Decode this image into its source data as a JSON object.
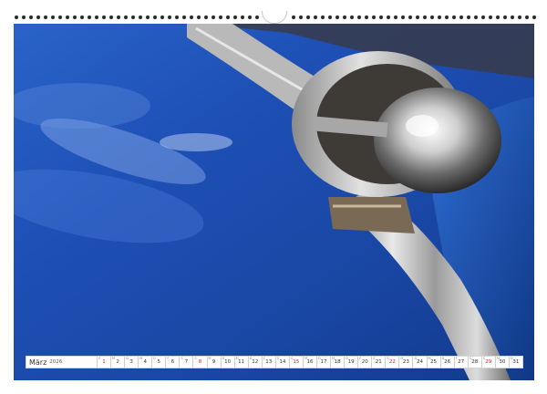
{
  "calendar": {
    "month": "März",
    "year": "2026",
    "days": [
      {
        "n": "1",
        "w": "S",
        "sun": true
      },
      {
        "n": "2",
        "w": "M"
      },
      {
        "n": "3",
        "w": "D"
      },
      {
        "n": "4",
        "w": "M"
      },
      {
        "n": "5",
        "w": "D"
      },
      {
        "n": "6",
        "w": "F"
      },
      {
        "n": "7",
        "w": "S"
      },
      {
        "n": "8",
        "w": "S",
        "sun": true
      },
      {
        "n": "9",
        "w": "M"
      },
      {
        "n": "10",
        "w": "D"
      },
      {
        "n": "11",
        "w": "M"
      },
      {
        "n": "12",
        "w": "D"
      },
      {
        "n": "13",
        "w": "F"
      },
      {
        "n": "14",
        "w": "S"
      },
      {
        "n": "15",
        "w": "S",
        "sun": true
      },
      {
        "n": "16",
        "w": "M"
      },
      {
        "n": "17",
        "w": "D"
      },
      {
        "n": "18",
        "w": "M"
      },
      {
        "n": "19",
        "w": "D"
      },
      {
        "n": "20",
        "w": "F"
      },
      {
        "n": "21",
        "w": "S"
      },
      {
        "n": "22",
        "w": "S",
        "sun": true
      },
      {
        "n": "23",
        "w": "M"
      },
      {
        "n": "24",
        "w": "D"
      },
      {
        "n": "25",
        "w": "M"
      },
      {
        "n": "26",
        "w": "D"
      },
      {
        "n": "27",
        "w": "F"
      },
      {
        "n": "28",
        "w": "S"
      },
      {
        "n": "29",
        "w": "S",
        "sun": true
      },
      {
        "n": "30",
        "w": "M"
      },
      {
        "n": "31",
        "w": "D"
      }
    ]
  },
  "colors": {
    "car_paint": "#1a49a6",
    "chrome": "#c8c8c8",
    "sunday": "#d6262a"
  }
}
